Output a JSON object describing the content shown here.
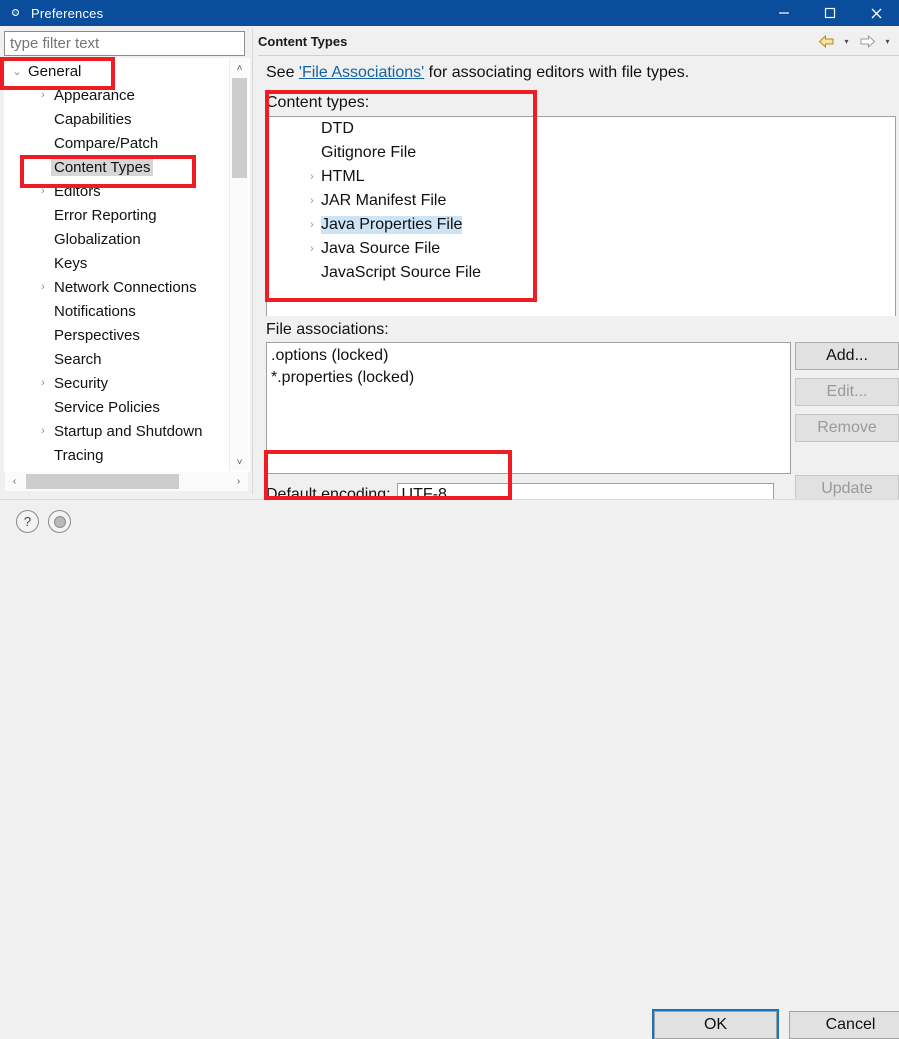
{
  "window": {
    "title": "Preferences",
    "icon": "preferences-gear-icon",
    "minimize_label": "–",
    "maximize_label": "□",
    "close_label": "✕"
  },
  "sidebar": {
    "filter": {
      "placeholder": "type filter text",
      "value": ""
    },
    "items": [
      {
        "label": "General",
        "level": 0,
        "twisty": "⌄",
        "expanded": true,
        "selected": false
      },
      {
        "label": "Appearance",
        "level": 1,
        "twisty": "›",
        "expanded": false,
        "selected": false
      },
      {
        "label": "Capabilities",
        "level": 1,
        "twisty": "",
        "expanded": false,
        "selected": false
      },
      {
        "label": "Compare/Patch",
        "level": 1,
        "twisty": "",
        "expanded": false,
        "selected": false
      },
      {
        "label": "Content Types",
        "level": 1,
        "twisty": "",
        "expanded": false,
        "selected": true
      },
      {
        "label": "Editors",
        "level": 1,
        "twisty": "›",
        "expanded": false,
        "selected": false
      },
      {
        "label": "Error Reporting",
        "level": 1,
        "twisty": "",
        "expanded": false,
        "selected": false
      },
      {
        "label": "Globalization",
        "level": 1,
        "twisty": "",
        "expanded": false,
        "selected": false
      },
      {
        "label": "Keys",
        "level": 1,
        "twisty": "",
        "expanded": false,
        "selected": false
      },
      {
        "label": "Network Connections",
        "level": 1,
        "twisty": "›",
        "expanded": false,
        "selected": false
      },
      {
        "label": "Notifications",
        "level": 1,
        "twisty": "",
        "expanded": false,
        "selected": false
      },
      {
        "label": "Perspectives",
        "level": 1,
        "twisty": "",
        "expanded": false,
        "selected": false
      },
      {
        "label": "Search",
        "level": 1,
        "twisty": "",
        "expanded": false,
        "selected": false
      },
      {
        "label": "Security",
        "level": 1,
        "twisty": "›",
        "expanded": false,
        "selected": false
      },
      {
        "label": "Service Policies",
        "level": 1,
        "twisty": "",
        "expanded": false,
        "selected": false
      },
      {
        "label": "Startup and Shutdown",
        "level": 1,
        "twisty": "›",
        "expanded": false,
        "selected": false
      },
      {
        "label": "Tracing",
        "level": 1,
        "twisty": "",
        "expanded": false,
        "selected": false
      }
    ],
    "scroll_up_glyph": "˄",
    "scroll_down_glyph": "˅",
    "scroll_left_glyph": "‹",
    "scroll_right_glyph": "›"
  },
  "pane": {
    "title": "Content Types",
    "nav": {
      "back_label": "back-arrow",
      "back_caret": "▾",
      "forward_label": "forward-arrow",
      "forward_caret": "▾"
    },
    "description": {
      "prefix": "See ",
      "link": "'File Associations'",
      "suffix": " for associating editors with file types."
    },
    "content_types_label": "Content types:",
    "content_types": [
      {
        "label": "DTD",
        "twisty": "",
        "selected": false
      },
      {
        "label": "Gitignore File",
        "twisty": "",
        "selected": false
      },
      {
        "label": "HTML",
        "twisty": "›",
        "selected": false
      },
      {
        "label": "JAR Manifest File",
        "twisty": "›",
        "selected": false
      },
      {
        "label": "Java Properties File",
        "twisty": "›",
        "selected": true
      },
      {
        "label": "Java Source File",
        "twisty": "›",
        "selected": false
      },
      {
        "label": "JavaScript Source File",
        "twisty": "",
        "selected": false
      }
    ],
    "file_associations_label": "File associations:",
    "file_associations": [
      ".options (locked)",
      "*.properties (locked)"
    ],
    "buttons": [
      {
        "label": "Add...",
        "enabled": true
      },
      {
        "label": "Edit...",
        "enabled": false
      },
      {
        "label": "Remove",
        "enabled": false
      },
      {
        "label": "Update",
        "enabled": false
      }
    ],
    "encoding": {
      "label": "Default encoding:",
      "value": "UTF-8"
    }
  },
  "footer": {
    "help_icon_label": "?",
    "apply_icon_label": "restore-defaults",
    "ok_label": "OK",
    "cancel_label": "Cancel"
  },
  "annotations": {
    "color": "#ee1c23",
    "boxes": [
      {
        "name": "general-highlight"
      },
      {
        "name": "content-types-sidebar-highlight"
      },
      {
        "name": "content-types-list-highlight"
      },
      {
        "name": "default-encoding-highlight"
      }
    ]
  }
}
